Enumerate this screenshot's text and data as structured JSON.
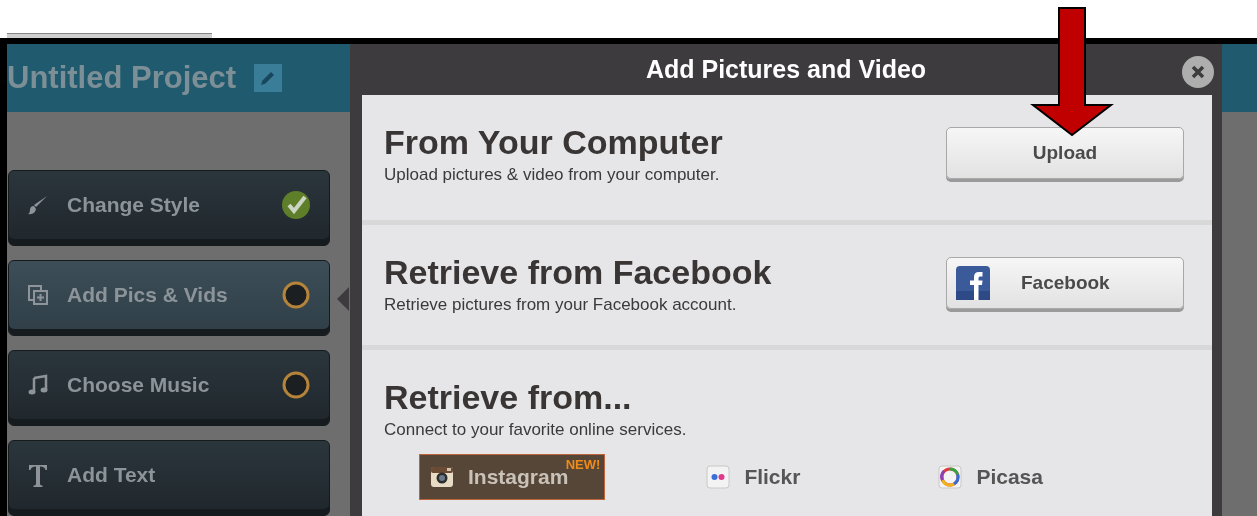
{
  "project": {
    "title": "Untitled Project"
  },
  "steps": [
    {
      "label": "Change Style",
      "selected": false,
      "checked": true
    },
    {
      "label": "Add Pics & Vids",
      "selected": true,
      "checked": false
    },
    {
      "label": "Choose Music",
      "selected": false,
      "checked": false
    },
    {
      "label": "Add Text",
      "selected": false
    }
  ],
  "dialog": {
    "title": "Add Pictures and Video",
    "sections": [
      {
        "kind": "button",
        "heading": "From Your Computer",
        "description": "Upload pictures & video from your computer.",
        "button": {
          "label": "Upload"
        }
      },
      {
        "kind": "button",
        "heading": "Retrieve from Facebook",
        "description": "Retrieve pictures from your Facebook account.",
        "button": {
          "label": "Facebook"
        }
      },
      {
        "kind": "services",
        "heading": "Retrieve from...",
        "description": "Connect to your favorite online services.",
        "services": [
          {
            "label": "Instagram",
            "selected": true,
            "badge": "NEW!"
          },
          {
            "label": "Flickr",
            "selected": false
          },
          {
            "label": "Picasa",
            "selected": false
          }
        ]
      }
    ]
  },
  "annotation": {
    "kind": "arrow"
  }
}
